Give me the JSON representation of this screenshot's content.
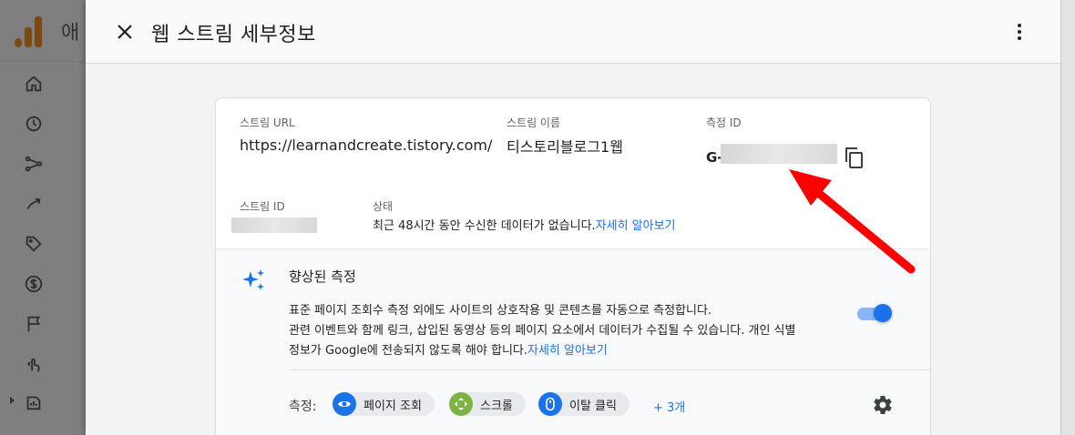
{
  "background_app": {
    "name_fragment": "애"
  },
  "drawer": {
    "title": "웹 스트림 세부정보",
    "close_icon": "close-icon",
    "more_icon": "more-vert-icon"
  },
  "stream": {
    "url_label": "스트림 URL",
    "url_value": "https://learnandcreate.tistory.com/",
    "name_label": "스트림 이름",
    "name_value": "티스토리블로그1웹",
    "measurement_id_label": "측정 ID",
    "measurement_id_prefix": "G-",
    "id_label": "스트림 ID",
    "status_label": "상태",
    "status_text": "최근 48시간 동안 수신한 데이터가 없습니다.",
    "status_link": "자세히 알아보기"
  },
  "enhanced": {
    "title": "향상된 측정",
    "desc_line1": "표준 페이지 조회수 측정 외에도 사이트의 상호작용 및 콘텐츠를 자동으로 측정합니다.",
    "desc_line2": "관련 이벤트와 함께 링크, 삽입된 동영상 등의 페이지 요소에서 데이터가 수집될 수 있습니다. 개인 식별",
    "desc_line3": "정보가 Google에 전송되지 않도록 해야 합니다.",
    "desc_link": "자세히 알아보기",
    "toggle_on": true,
    "measure_label": "측정:",
    "chips": [
      {
        "label": "페이지 조회",
        "icon": "eye-icon",
        "color": "#1a73e8"
      },
      {
        "label": "스크롤",
        "icon": "scroll-icon",
        "color": "#7cb342"
      },
      {
        "label": "이탈 클릭",
        "icon": "mouse-icon",
        "color": "#1a73e8"
      }
    ],
    "more_link": "+ 3개"
  },
  "colors": {
    "accent": "#1a73e8",
    "annotation_arrow": "#ff0000"
  }
}
